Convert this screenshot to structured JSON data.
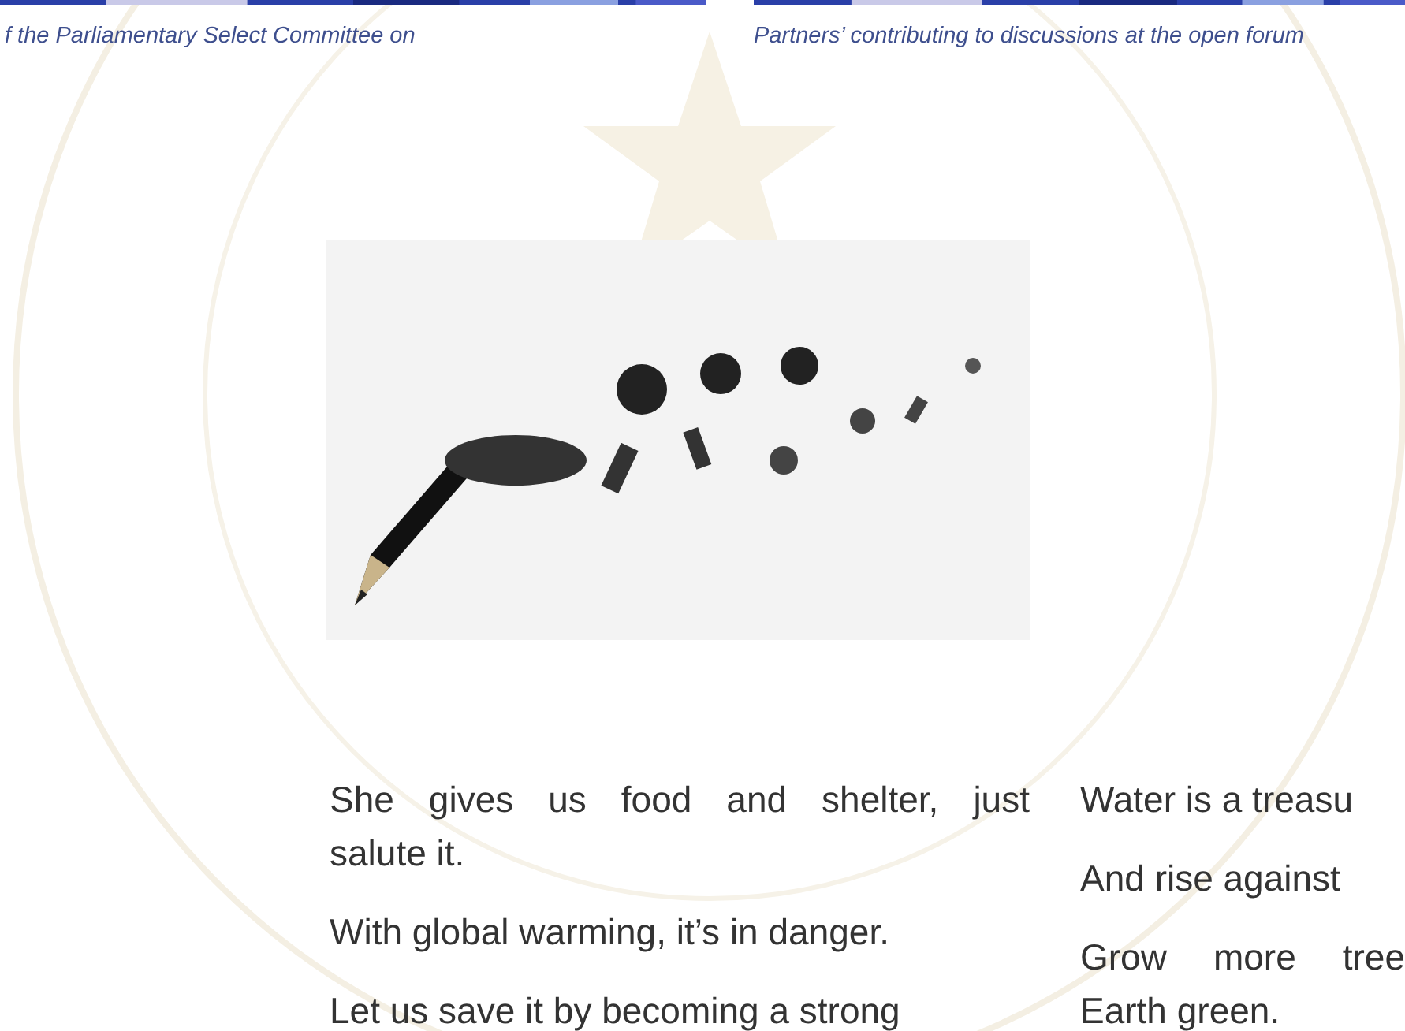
{
  "gallery": [
    {
      "caption": "f the Parliamentary Select Committee on"
    },
    {
      "caption": "Partners’ contributing to discussions at the open forum"
    }
  ],
  "poem": {
    "columns": [
      {
        "paragraphs": [
          {
            "lines": [
              "She gives us food and shelter, just",
              "salute it."
            ]
          },
          {
            "lines": [
              "With global warming, it’s in danger."
            ]
          },
          {
            "lines": [
              "Let us save it by becoming a strong"
            ]
          }
        ]
      },
      {
        "paragraphs": [
          {
            "lines": [
              "Water is a treasu"
            ]
          },
          {
            "lines": [
              "And rise against"
            ]
          },
          {
            "lines": [
              "Grow more tree",
              "Earth green."
            ]
          }
        ]
      }
    ]
  }
}
